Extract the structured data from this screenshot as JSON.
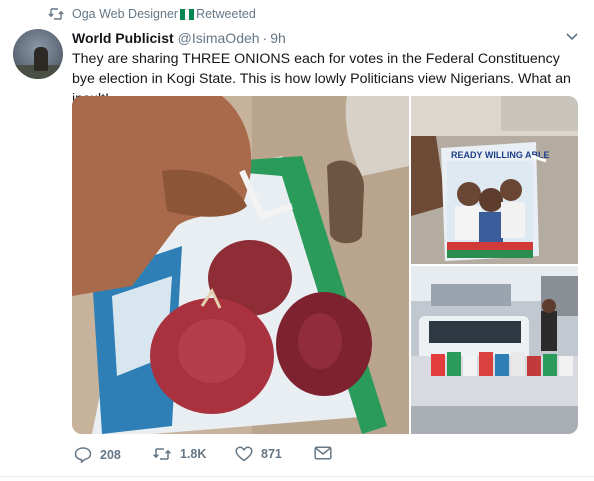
{
  "retweet": {
    "user": "Oga Web Designer",
    "label": "Retweeted",
    "flag_colors": [
      "#008751",
      "#ffffff",
      "#008751"
    ]
  },
  "tweet": {
    "name": "World Publicist",
    "handle": "@IsimaOdeh",
    "separator": "·",
    "time": "9h",
    "text": "They are sharing THREE ONIONS each for votes in the Federal Constituency bye election in Kogi State. This is how lowly Politicians view Nigerians. What an insult!"
  },
  "media": {
    "items": [
      "onions-photo",
      "campaign-bag-photo",
      "pickup-truck-photo"
    ],
    "bag_text": "READY WILLING ABLE"
  },
  "actions": {
    "reply_count": "208",
    "retweet_count": "1.8K",
    "like_count": "871"
  },
  "icons": [
    "retweet-icon",
    "chevron-down-icon",
    "reply-icon",
    "retweet-icon",
    "heart-icon",
    "mail-icon"
  ],
  "colors": {
    "text": "#14171a",
    "muted": "#657786",
    "divider": "#e6ecf0"
  }
}
